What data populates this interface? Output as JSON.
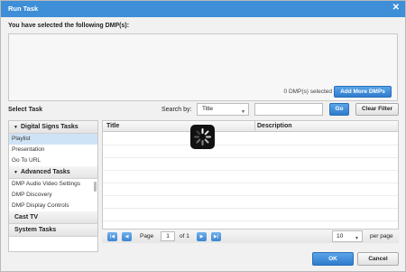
{
  "dialog": {
    "title": "Run Task"
  },
  "selection": {
    "label": "You have selected the following DMP(s):",
    "count_text": "0 DMP(s) selected",
    "add_more_label": "Add More DMPs"
  },
  "toolbar": {
    "select_task_label": "Select Task",
    "search_by_label": "Search by:",
    "search_by_value": "Title",
    "search_value": "",
    "go_label": "Go",
    "clear_filter_label": "Clear Filter"
  },
  "task_groups": [
    {
      "name": "Digital Signs Tasks",
      "expanded": true,
      "items": [
        "Playlist",
        "Presentation",
        "Go To URL"
      ],
      "selected": "Playlist"
    },
    {
      "name": "Advanced Tasks",
      "expanded": true,
      "items": [
        "DMP Audio Video Settings",
        "DMP Discovery",
        "DMP Display Controls"
      ]
    },
    {
      "name": "Cast TV",
      "expanded": false,
      "items": []
    },
    {
      "name": "System Tasks",
      "expanded": false,
      "items": []
    }
  ],
  "grid": {
    "columns": [
      "Title",
      "Description"
    ],
    "rows": []
  },
  "pager": {
    "page_label": "Page",
    "current_page": "1",
    "of_label": "of 1",
    "per_page_value": "10",
    "per_page_label": "per page"
  },
  "footer": {
    "ok_label": "OK",
    "cancel_label": "Cancel"
  },
  "icons": {
    "close": "close-icon",
    "first": "first-page-icon",
    "prev": "previous-page-icon",
    "next": "next-page-icon",
    "last": "last-page-icon",
    "loading": "loading-spinner-icon"
  },
  "colors": {
    "accent": "#3e8ed8",
    "selected_row": "#cfe3f6"
  }
}
